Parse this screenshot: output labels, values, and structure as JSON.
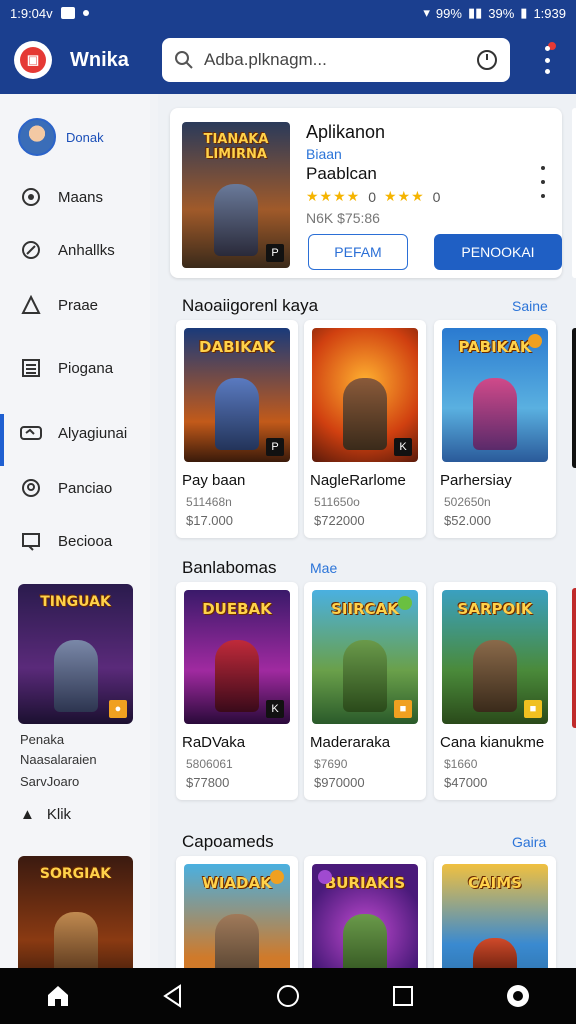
{
  "status_bar": {
    "time": "1:9:04v",
    "battery": "99%",
    "signal": "39%",
    "clock_right": "1:939"
  },
  "app_bar": {
    "title": "Wnika",
    "search_value": "Adba.plknagm..."
  },
  "sidebar": {
    "profile_name": "Donak",
    "items": [
      {
        "label": "Maans",
        "icon": "info-icon"
      },
      {
        "label": "Anhallks",
        "icon": "compass-icon"
      },
      {
        "label": "Praae",
        "icon": "triangle-icon"
      },
      {
        "label": "Piogana",
        "icon": "list-icon"
      },
      {
        "label": "Alyagiunai",
        "icon": "gamepad-icon"
      },
      {
        "label": "Panciao",
        "icon": "smile-icon"
      },
      {
        "label": "Beciooa",
        "icon": "screen-icon"
      }
    ],
    "promo_card_1_title": "TINGUAK",
    "promo_text": [
      "Penaka",
      "Naasalaraien",
      "SarvJoaro"
    ],
    "link_label": "Klik",
    "promo_card_2_title": "SORGIAK"
  },
  "featured": {
    "art_title": "TIANAKA\nLIMIRNA",
    "title": "Aplikanon",
    "subtitle": "Biaan",
    "name": "Paablcan",
    "rating_1": "0",
    "rating_2": "0",
    "price": "N6K $75:86",
    "btn_outline": "PEFAM",
    "btn_fill": "PENOOKAI"
  },
  "sections": [
    {
      "title": "Naoaiigorenl kaya",
      "link": "Saine",
      "cards": [
        {
          "art": "DABIKAK",
          "title": "Pay baan",
          "line1": "511468n",
          "line2": "$17.000"
        },
        {
          "art": "",
          "title": "NagleRarlome",
          "line1": "511650o",
          "line2": "$722000"
        },
        {
          "art": "PABIKAK",
          "title": "Parhersiay",
          "line1": "502650n",
          "line2": "$52.000"
        }
      ]
    },
    {
      "title": "Banlabomas",
      "link": "Mae",
      "cards": [
        {
          "art": "DUEBAK",
          "title": "RaDVaka",
          "line1": "5806061",
          "line2": "$77800"
        },
        {
          "art": "SIIRCAK",
          "title": "Maderaraka",
          "line1": "$7690",
          "line2": "$970000"
        },
        {
          "art": "SARPOIK",
          "title": "Cana kianukme",
          "line1": "$1660",
          "line2": "$47000"
        }
      ]
    },
    {
      "title": "Capoameds",
      "link": "Gaira",
      "cards": [
        {
          "art": "WIADAK",
          "title": "",
          "line1": "",
          "line2": ""
        },
        {
          "art": "BURIAKIS",
          "title": "",
          "line1": "",
          "line2": ""
        },
        {
          "art": "CAIMS",
          "title": "",
          "line1": "",
          "line2": ""
        }
      ]
    }
  ],
  "colors": {
    "primary": "#1b3f8f",
    "accent": "#1f5fc4",
    "link": "#2b74d8",
    "star": "#f5b400"
  }
}
